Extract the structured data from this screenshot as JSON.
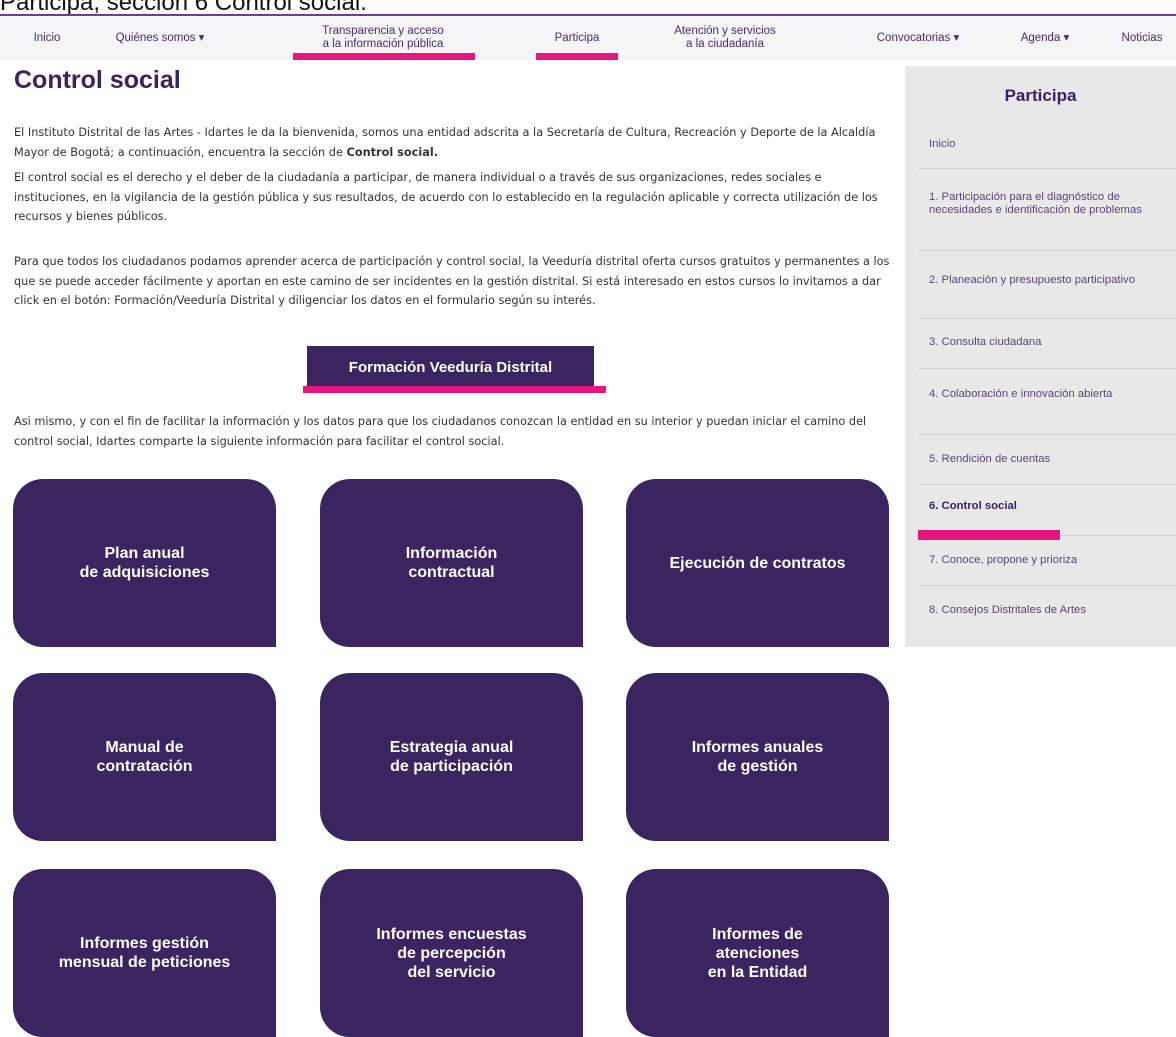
{
  "caption": "Participa, sección 6 Control social.",
  "nav": {
    "items": [
      {
        "label": "Inicio"
      },
      {
        "label": "Quiénes somos ▾"
      },
      {
        "label": "Transparencia y acceso\na la información pública"
      },
      {
        "label": "Participa"
      },
      {
        "label": "Atención y servicios\na la ciudadanía"
      },
      {
        "label": "Convocatorias ▾"
      },
      {
        "label": "Agenda ▾"
      },
      {
        "label": "Noticias"
      }
    ]
  },
  "main": {
    "title": "Control social",
    "para1_text": "El Instituto Distrital de las Artes - Idartes le da la bienvenida, somos una entidad adscrita a la Secretaría de Cultura, Recreación y Deporte de la Alcaldía Mayor de Bogotá; a continuación, encuentra la sección de ",
    "para1_bold": "Control social.",
    "para2": "El control social es el derecho y el deber de la ciudadanía a participar, de manera individual o a través de sus organizaciones, redes sociales e instituciones, en la vigilancia de la gestión pública y sus resultados, de acuerdo con lo establecido en la regulación aplicable y correcta utilización de los recursos y bienes públicos.",
    "para3": "Para que todos los ciudadanos podamos aprender acerca de participación y control social, la Veeduría distrital oferta cursos gratuitos y permanentes a los que se puede acceder fácilmente y aportan en este camino de ser incidentes en la gestión distrital. Si está interesado en estos cursos lo invitamos a dar click en el botón: Formación/Veeduría Distrital y diligenciar los datos en el formulario según su interés.",
    "cta_label": "Formación Veeduría Distrital",
    "para4": "Asi mismo, y con el fin de facilitar la información y los datos para que los ciudadanos conozcan la entidad en su interior y puedan iniciar el camino del control social, Idartes comparte la siguiente información para facilitar el control social.",
    "cards": [
      {
        "label": "Plan anual\nde adquisiciones"
      },
      {
        "label": "Información\ncontractual"
      },
      {
        "label": "Ejecución de contratos"
      },
      {
        "label": "Manual de\ncontratación"
      },
      {
        "label": "Estrategia anual\nde participación"
      },
      {
        "label": "Informes anuales\nde gestión"
      },
      {
        "label": "Informes gestión\nmensual de peticiones"
      },
      {
        "label": "Informes encuestas\nde percepción\ndel servicio"
      },
      {
        "label": "Informes de\natenciones\nen la Entidad"
      }
    ]
  },
  "sidebar": {
    "title": "Participa",
    "items": [
      {
        "label": "Inicio"
      },
      {
        "label": "1. Participación para el diagnóstico de necesidades e identificación de problemas"
      },
      {
        "label": "2. Planeación y presupuesto participativo"
      },
      {
        "label": "3. Consulta ciudadana"
      },
      {
        "label": "4. Colaboración e innovación abierta"
      },
      {
        "label": "5. Rendición de cuentas"
      },
      {
        "label": "6. Control social"
      },
      {
        "label": "7. Conoce, propone y prioriza"
      },
      {
        "label": "8. Consejos Distritales de Artes"
      }
    ]
  },
  "colors": {
    "brand_purple": "#3b2560",
    "highlight_pink": "#e6157f"
  }
}
